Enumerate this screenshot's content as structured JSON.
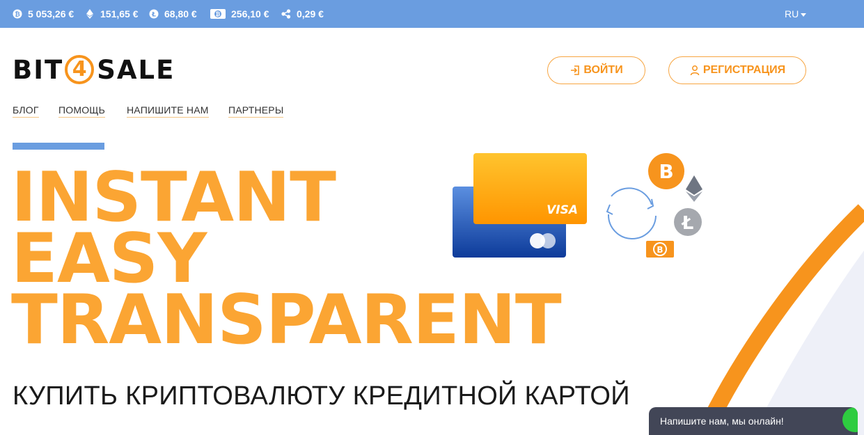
{
  "ticker": {
    "items": [
      {
        "icon": "bitcoin-icon",
        "price": "5 053,26 €"
      },
      {
        "icon": "ethereum-icon",
        "price": "151,65 €"
      },
      {
        "icon": "litecoin-icon",
        "price": "68,80 €"
      },
      {
        "icon": "bitcoin-cash-icon",
        "price": "256,10 €"
      },
      {
        "icon": "ripple-icon",
        "price": "0,29 €"
      }
    ],
    "language": "RU"
  },
  "header": {
    "logo": {
      "left": "BIT",
      "digit": "4",
      "right": "SALE"
    },
    "login_label": "ВОЙТИ",
    "register_label": "РЕГИСТРАЦИЯ"
  },
  "nav": {
    "items": [
      {
        "label": "БЛОГ"
      },
      {
        "label": "ПОМОЩЬ"
      },
      {
        "label": "НАПИШИТЕ НАМ"
      },
      {
        "label": "ПАРТНЕРЫ"
      }
    ]
  },
  "hero": {
    "lines": [
      "INSTANT",
      "EASY",
      "TRANSPARENT"
    ],
    "subtitle": "КУПИТЬ КРИПТОВАЛЮТУ КРЕДИТНОЙ КАРТОЙ"
  },
  "illustration": {
    "card_brand": "VISA",
    "coin_symbol": "B",
    "litecoin_symbol": "Ł"
  },
  "chat": {
    "label": "Напишите нам, мы онлайн!"
  },
  "colors": {
    "accent_orange": "#f7941d",
    "hero_orange": "#fba533",
    "ticker_blue": "#6a9de0",
    "chat_bg": "#424657",
    "online_green": "#2ecc40"
  }
}
